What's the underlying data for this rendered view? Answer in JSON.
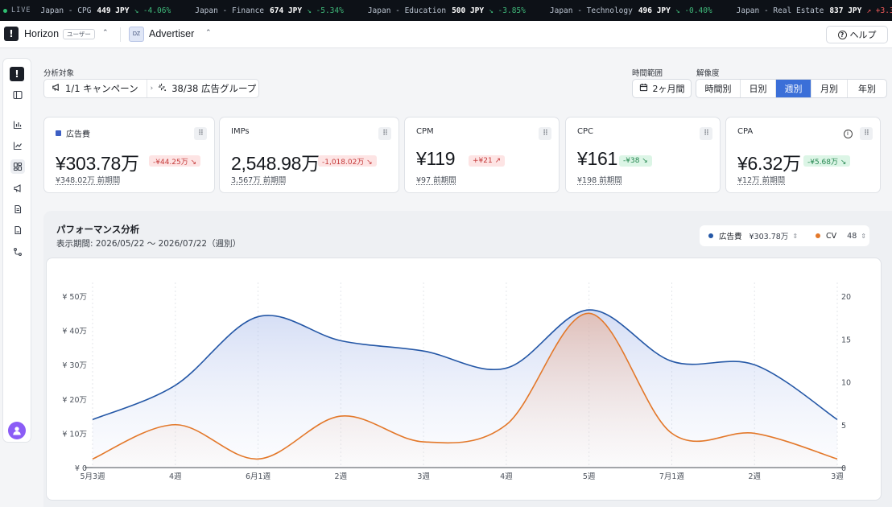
{
  "ticker": {
    "live_label": "LIVE",
    "items": [
      {
        "name": "Japan - CPG",
        "price": "449 JPY",
        "change": "↘ -4.06%",
        "dir": "down"
      },
      {
        "name": "Japan - Finance",
        "price": "674 JPY",
        "change": "↘ -5.34%",
        "dir": "down"
      },
      {
        "name": "Japan - Education",
        "price": "500 JPY",
        "change": "↘ -3.85%",
        "dir": "down"
      },
      {
        "name": "Japan - Technology",
        "price": "496 JPY",
        "change": "↘ -0.40%",
        "dir": "down"
      },
      {
        "name": "Japan - Real Estate",
        "price": "837 JPY",
        "change": "↗ +3.3",
        "dir": "up"
      }
    ]
  },
  "header": {
    "brand_name": "Horizon",
    "user_badge": "ユーザー",
    "advertiser_initials": "DZ",
    "advertiser_name": "Advertiser",
    "help_label": "ヘルプ"
  },
  "filters": {
    "scope_label": "分析対象",
    "campaign_label": "1/1 キャンペーン",
    "adgroup_label": "38/38 広告グループ",
    "range_label": "時間範囲",
    "range_value": "2ヶ月間",
    "resolution_label": "解像度",
    "resolution_options": [
      "時間別",
      "日別",
      "週別",
      "月別",
      "年別"
    ],
    "resolution_selected": "週別"
  },
  "kpis": [
    {
      "title": "広告費",
      "value": "¥303.78万",
      "delta": "-¥44.25万 ↘",
      "delta_tone": "red",
      "prev": "¥348.02万 前期間",
      "has_marker": true,
      "has_info": false
    },
    {
      "title": "IMPs",
      "value": "2,548.98万",
      "delta": "-1,018.02万 ↘",
      "delta_tone": "red",
      "prev": "3,567万 前期間",
      "has_marker": false,
      "has_info": false
    },
    {
      "title": "CPM",
      "value": "¥119",
      "delta": "+¥21 ↗",
      "delta_tone": "red",
      "prev": "¥97 前期間",
      "has_marker": false,
      "has_info": false
    },
    {
      "title": "CPC",
      "value": "¥161",
      "delta": "-¥38 ↘",
      "delta_tone": "green",
      "prev": "¥198 前期間",
      "has_marker": false,
      "has_info": false
    },
    {
      "title": "CPA",
      "value": "¥6.32万",
      "delta": "-¥5.68万 ↘",
      "delta_tone": "green",
      "prev": "¥12万 前期間",
      "has_marker": false,
      "has_info": true
    }
  ],
  "performance": {
    "title": "パフォーマンス分析",
    "period": "表示期間: 2026/05/22 〜 2026/07/22（週別）",
    "legend": [
      {
        "name": "広告費",
        "value": "¥303.78万",
        "color": "#2457a6"
      },
      {
        "name": "CV",
        "value": "48",
        "color": "#e3782a"
      }
    ]
  },
  "colors": {
    "accent": "#3b6fd8",
    "spend_line": "#2457a6",
    "cv_line": "#e3782a"
  },
  "chart_data": {
    "type": "line",
    "categories": [
      "5月3週",
      "4週",
      "6月1週",
      "2週",
      "3週",
      "4週",
      "5週",
      "7月1週",
      "2週",
      "3週"
    ],
    "series": [
      {
        "name": "広告費",
        "axis": "left",
        "values": [
          140000,
          240000,
          440000,
          370000,
          340000,
          290000,
          460000,
          310000,
          300000,
          140000
        ]
      },
      {
        "name": "CV",
        "axis": "right",
        "values": [
          1,
          5,
          1,
          6,
          3,
          5,
          18,
          4,
          4,
          1
        ]
      }
    ],
    "y_left": {
      "ticks": [
        "¥ 0",
        "¥ 10万",
        "¥ 20万",
        "¥ 30万",
        "¥ 40万",
        "¥ 50万"
      ],
      "min": 0,
      "max": 500000
    },
    "y_right": {
      "ticks": [
        "0",
        "5",
        "10",
        "15",
        "20"
      ],
      "min": 0,
      "max": 20
    },
    "grid": true
  }
}
